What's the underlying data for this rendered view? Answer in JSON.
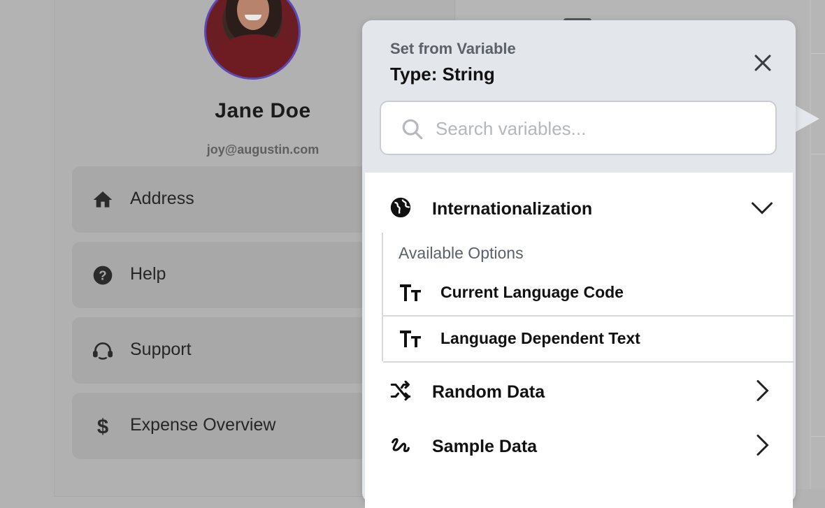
{
  "profile": {
    "name": "Jane Doe",
    "email": "joy@augustin.com"
  },
  "menu": [
    {
      "label": "Address",
      "icon": "home-icon"
    },
    {
      "label": "Help",
      "icon": "help-icon"
    },
    {
      "label": "Support",
      "icon": "support-agent-icon"
    },
    {
      "label": "Expense Overview",
      "icon": "dollar-icon"
    }
  ],
  "popup": {
    "subtitle": "Set from Variable",
    "title": "Type: String",
    "search_placeholder": "Search variables...",
    "groups": {
      "internationalization": {
        "label": "Internationalization",
        "options_label": "Available Options",
        "options": [
          {
            "label": "Current Language Code"
          },
          {
            "label": "Language Dependent Text"
          }
        ]
      },
      "random": {
        "label": "Random Data"
      },
      "sample": {
        "label": "Sample Data"
      }
    }
  },
  "colors": {
    "avatar_ring": "#5b49b5",
    "popup_bg": "#e3e6eb",
    "text_primary": "#111111",
    "text_secondary": "#5b6169"
  }
}
